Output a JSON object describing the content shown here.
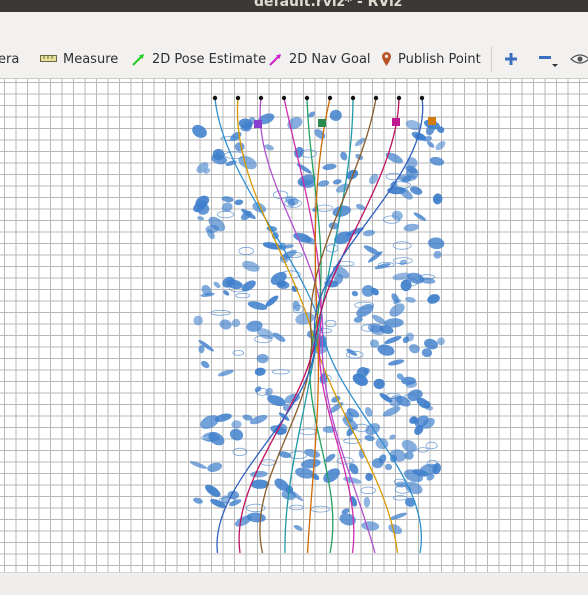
{
  "window": {
    "title": "default.rviz* - RViz"
  },
  "toolbar": {
    "camera_label": "era",
    "measure_label": "Measure",
    "pose_estimate_label": "2D Pose Estimate",
    "nav_goal_label": "2D Nav Goal",
    "publish_point_label": "Publish Point"
  },
  "colors": {
    "grid": "#b9b9b9",
    "obstacles": "#3f7fcc",
    "pose_estimate_arrow": "#22cc22",
    "nav_goal_arrow": "#cc22cc",
    "publish_point_pin": "#b8532a",
    "plus": "#3a6fbf",
    "minus": "#3a6fbf"
  },
  "scene": {
    "type": "multi-agent crowd trajectories",
    "agent_count": 10,
    "trajectory_colors": [
      "#2f8fd0",
      "#d99a00",
      "#b14fd0",
      "#d12ab0",
      "#22a060",
      "#d06a00",
      "#1f9aa8",
      "#8a5c2a",
      "#c01060",
      "#3060c0"
    ],
    "marker_colors": [
      "#8a3fd1",
      "#2a8a4a",
      "#c0188e",
      "#d07a10"
    ]
  }
}
